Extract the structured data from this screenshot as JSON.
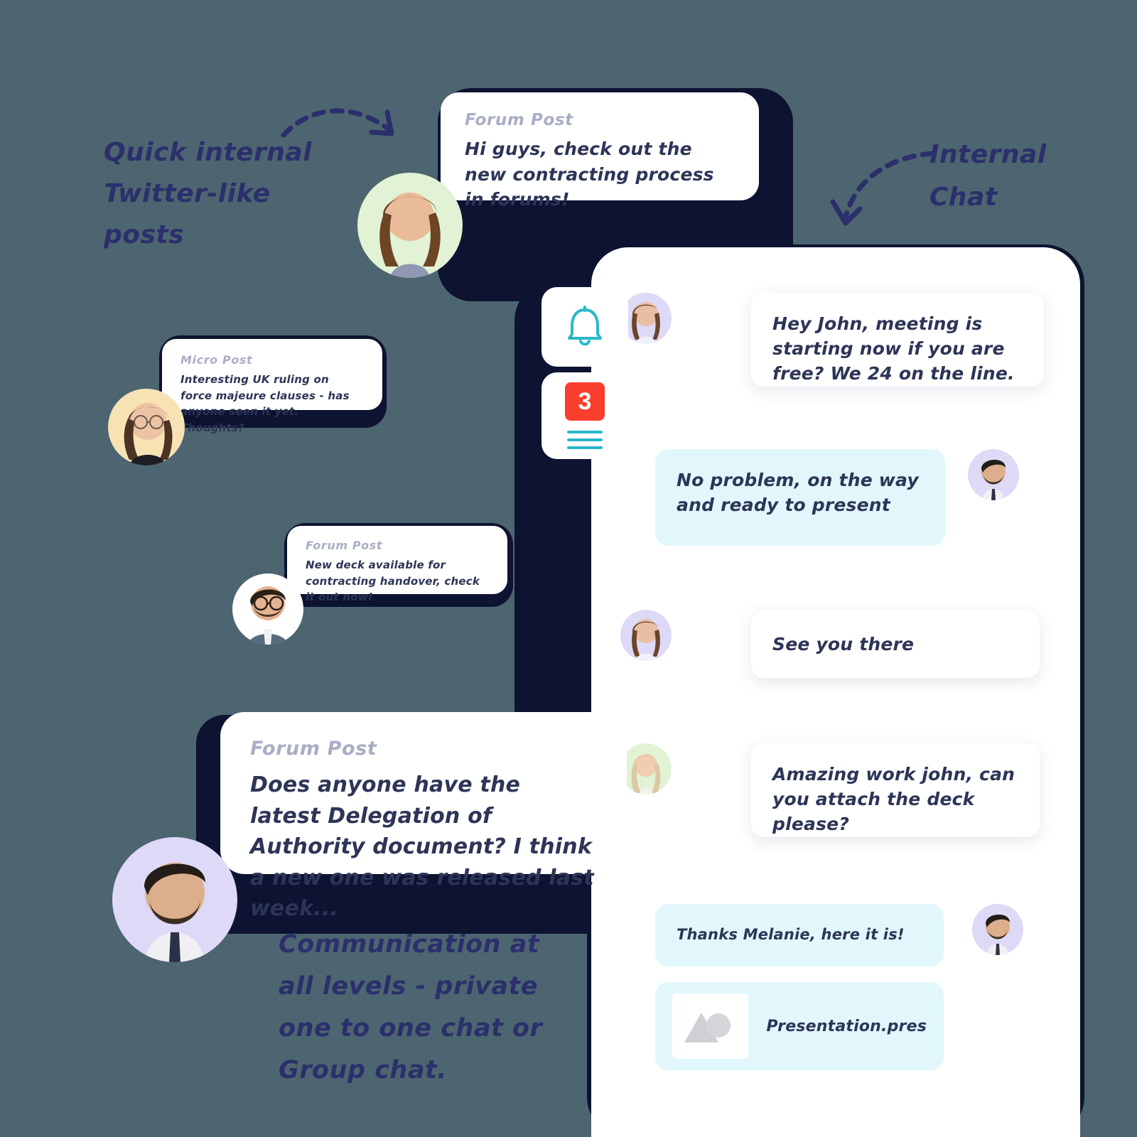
{
  "annotations": {
    "left": "Quick internal Twitter-like posts",
    "right": "Internal Chat",
    "bottom": "Communication at all levels - private one to one chat or Group chat."
  },
  "colors": {
    "background": "#4c6570",
    "dark_panel": "#0d1330",
    "ink": "#2d3557",
    "annotation_ink": "#2b2f6b",
    "label_muted": "#a9aec6",
    "teal": "#2ab8c9",
    "badge_red": "#f93e2e",
    "outgoing_bubble": "#e1f7fb",
    "avatar_lavender": "#ddd9f7",
    "avatar_green": "#e2f2d4",
    "avatar_cream": "#f7e2b4"
  },
  "posts": [
    {
      "label": "Forum Post",
      "body": "Hi guys, check out the new contracting process in forums!",
      "avatar_bg": "#e2f2d4"
    },
    {
      "label": "Micro Post",
      "body": "Interesting UK ruling on force majeure clauses - has anyone seen it yet. Thoughts?",
      "avatar_bg": "#f7e2b4"
    },
    {
      "label": "Forum Post",
      "body": "New deck available for contracting handover, check it out now!",
      "avatar_bg": "#ffffff"
    },
    {
      "label": "Forum Post",
      "body": "Does anyone have the latest Delegation of Authority document? I think a new one was released last week...",
      "avatar_bg": "#ddd9f7"
    }
  ],
  "nav": {
    "bell_icon": "bell-icon",
    "badge_count": "3",
    "menu_icon": "hamburger-menu-icon"
  },
  "chat": {
    "messages": [
      {
        "direction": "incoming",
        "text": "Hey John, meeting is starting now if you are free? We 24 on the line.",
        "avatar_bg": "#ddd9f7"
      },
      {
        "direction": "outgoing",
        "text": "No problem, on the way and ready to present",
        "avatar_bg": "#ddd9f7"
      },
      {
        "direction": "incoming",
        "text": "See you there",
        "avatar_bg": "#ddd9f7"
      },
      {
        "direction": "incoming",
        "text": "Amazing work john, can you attach the deck please?",
        "avatar_bg": "#e2f2d4"
      },
      {
        "direction": "outgoing",
        "text": "Thanks Melanie, here it is!",
        "avatar_bg": "#ddd9f7"
      }
    ],
    "attachment": {
      "file_name": "Presentation.pres",
      "thumb_icon": "image-placeholder-icon"
    }
  }
}
